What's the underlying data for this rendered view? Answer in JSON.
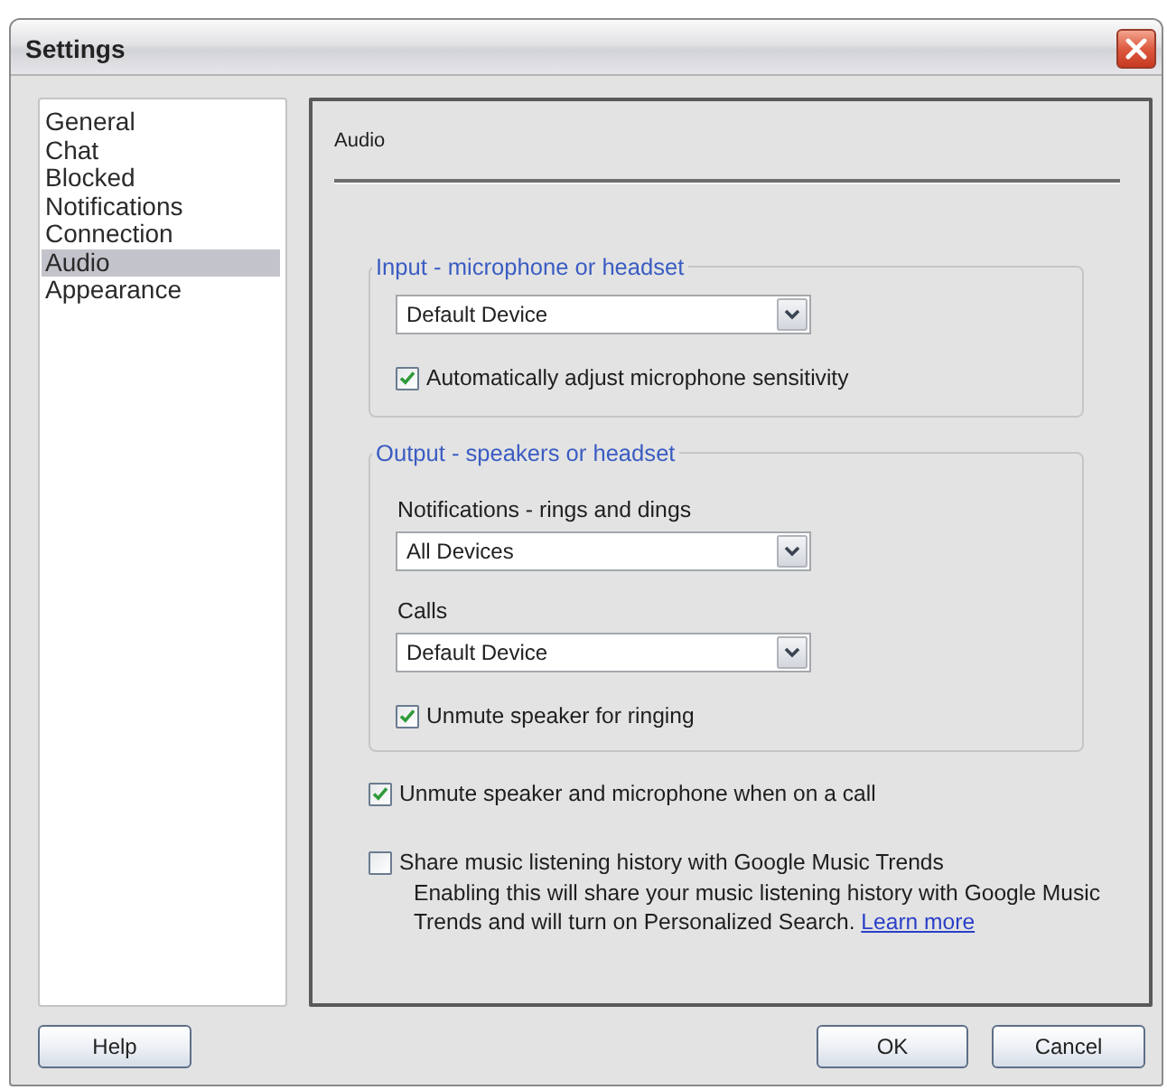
{
  "window": {
    "title": "Settings"
  },
  "sidebar": {
    "items": [
      {
        "label": "General",
        "selected": false
      },
      {
        "label": "Chat",
        "selected": false
      },
      {
        "label": "Blocked",
        "selected": false
      },
      {
        "label": "Notifications",
        "selected": false
      },
      {
        "label": "Connection",
        "selected": false
      },
      {
        "label": "Audio",
        "selected": true
      },
      {
        "label": "Appearance",
        "selected": false
      }
    ]
  },
  "panel": {
    "title": "Audio",
    "input_group": {
      "title": "Input - microphone or headset",
      "device": "Default Device",
      "auto_adjust": {
        "label": "Automatically adjust microphone sensitivity",
        "checked": true
      }
    },
    "output_group": {
      "title": "Output - speakers or headset",
      "fields": [
        {
          "label": "Notifications - rings and dings",
          "value": "All Devices"
        },
        {
          "label": "Calls",
          "value": "Default Device"
        }
      ],
      "unmute_ringing": {
        "label": "Unmute speaker for ringing",
        "checked": true
      }
    },
    "options": [
      {
        "label": "Unmute speaker and microphone when on a call",
        "checked": true
      },
      {
        "label": "Share music listening history with Google Music Trends",
        "checked": false,
        "description": "Enabling this will share your music listening history with Google Music Trends and will turn on Personalized Search.",
        "link": "Learn more"
      }
    ]
  },
  "buttons": {
    "help": "Help",
    "ok": "OK",
    "cancel": "Cancel"
  }
}
